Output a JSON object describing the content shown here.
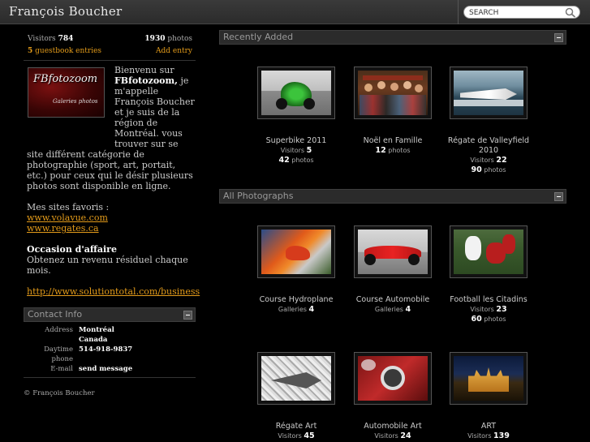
{
  "header": {
    "title": "François Boucher",
    "search_placeholder": "SEARCH"
  },
  "sidebar": {
    "stats": {
      "visitors_label": "Visitors",
      "visitors_value": "784",
      "photos_value": "1930",
      "photos_label": "photos",
      "guestbook_count": "5",
      "guestbook_label": "guestbook entries",
      "add_entry": "Add entry"
    },
    "logo": {
      "title": "FBfotozoom",
      "subtitle": "Galeries photos"
    },
    "intro": {
      "p1_pre": "Bienvenu sur ",
      "p1_bold": "FBfotozoom,",
      "p1_post": " je m'appelle François Boucher et je suis de la région de Montréal. vous trouver sur se site différent catégorie de photographie (sport, art, portait, etc.) pour ceux qui le désir plusieurs photos sont disponible en ligne.",
      "fav_label": "Mes sites favoris :",
      "fav_links": [
        "www.volavue.com",
        "www.regates.ca"
      ],
      "biz_title": "Occasion d'affaire",
      "biz_text": "Obtenez un revenu résiduel chaque mois.",
      "biz_link": "http://www.solutiontotal.com/business"
    },
    "contact": {
      "header": "Contact Info",
      "address_label": "Address",
      "address_line1": "Montréal",
      "address_line2": "Canada",
      "phone_label": "Daytime phone",
      "phone_value": "514-918-9837",
      "email_label": "E-mail",
      "email_value": "send message"
    },
    "copyright": "© François Boucher"
  },
  "recent": {
    "header": "Recently Added",
    "items": [
      {
        "title": "Superbike 2011",
        "line1_label": "Visitors",
        "line1_value": "5",
        "line2_value": "42",
        "line2_label": "photos"
      },
      {
        "title": "Noël en Famille",
        "line1_label": "",
        "line1_value": "12",
        "line1_suffix": "photos"
      },
      {
        "title": "Régate de Valleyfield 2010",
        "line1_label": "Visitors",
        "line1_value": "22",
        "line2_value": "90",
        "line2_label": "photos"
      }
    ]
  },
  "all": {
    "header": "All Photographs",
    "items": [
      {
        "title": "Course Hydroplane",
        "line1_label": "Galleries",
        "line1_value": "4"
      },
      {
        "title": "Course Automobile",
        "line1_label": "Galleries",
        "line1_value": "4"
      },
      {
        "title": "Football les Citadins",
        "line1_label": "Visitors",
        "line1_value": "23",
        "line2_value": "60",
        "line2_label": "photos"
      },
      {
        "title": "Régate Art",
        "line1_label": "Visitors",
        "line1_value": "45"
      },
      {
        "title": "Automobile Art",
        "line1_label": "Visitors",
        "line1_value": "24"
      },
      {
        "title": "ART",
        "line1_label": "Visitors",
        "line1_value": "139"
      }
    ]
  }
}
